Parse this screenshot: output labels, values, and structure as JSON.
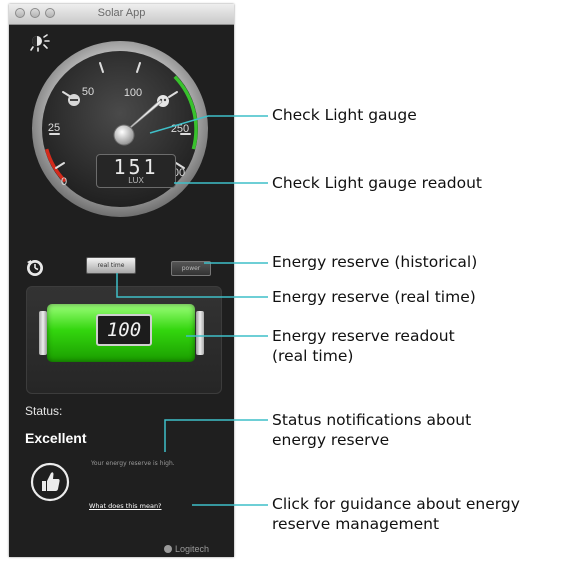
{
  "window": {
    "title": "Solar App"
  },
  "gauge": {
    "tick_labels": [
      "0",
      "25",
      "50",
      "100",
      "250",
      "500"
    ],
    "readout": "151",
    "unit": "LUX",
    "value_lux": 151,
    "colors": {
      "low": "#d42b1c",
      "high": "#38c22c"
    }
  },
  "energy": {
    "realtime_label": "real time",
    "historical_label": "power",
    "readout": "100",
    "level_fraction": 1.0,
    "battery_color": "#33d60e"
  },
  "status": {
    "label": "Status:",
    "value": "Excellent",
    "message": "Your energy reserve is high.",
    "guidance_link": "What does this mean?"
  },
  "brand": {
    "name": "Logitech"
  },
  "callouts": [
    {
      "lines": [
        "Check Light gauge"
      ]
    },
    {
      "lines": [
        "Check Light gauge readout"
      ]
    },
    {
      "lines": [
        "Energy reserve (historical)"
      ]
    },
    {
      "lines": [
        "Energy reserve (real time)"
      ]
    },
    {
      "lines": [
        "Energy reserve readout",
        "(real time)"
      ]
    },
    {
      "lines": [
        "Status notifications about",
        "energy reserve"
      ]
    },
    {
      "lines": [
        "Click for guidance about energy",
        "reserve management"
      ]
    }
  ],
  "icons": {
    "sun": "sun-icon",
    "history": "history-icon",
    "thumbs_up": "thumbs-up-icon"
  }
}
